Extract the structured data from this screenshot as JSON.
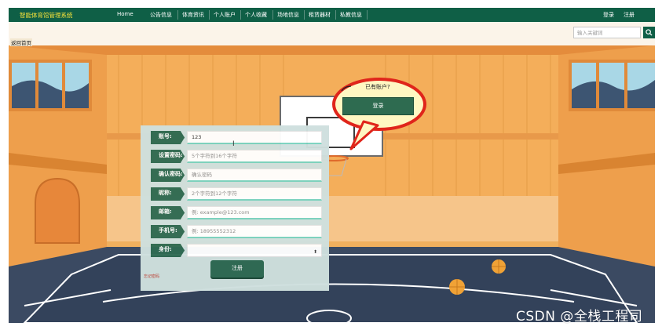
{
  "nav": {
    "brand": "智能体育馆管理系统",
    "items": [
      "Home",
      "公告信息",
      "体育资讯",
      "个人账户",
      "个人收藏",
      "场地信息",
      "租赁器材",
      "私教信息"
    ],
    "login": "登录",
    "register": "注册"
  },
  "search": {
    "placeholder": "输入关键词",
    "icon": "search-icon"
  },
  "back_label": "返回首页",
  "balloon": {
    "text": "已有账户?",
    "login_button": "登录"
  },
  "form": {
    "fields": [
      {
        "label": "账号:",
        "value": "123",
        "placeholder": ""
      },
      {
        "label": "设置密码:",
        "value": "",
        "placeholder": "5个字符到16个字符"
      },
      {
        "label": "确认密码:",
        "value": "",
        "placeholder": "确认密码"
      },
      {
        "label": "昵称:",
        "value": "",
        "placeholder": "2个字符到12个字符"
      },
      {
        "label": "邮箱:",
        "value": "",
        "placeholder": "例: example@123.com"
      },
      {
        "label": "手机号:",
        "value": "",
        "placeholder": "例: 18955552312"
      },
      {
        "label": "身份:",
        "value": "",
        "placeholder": ""
      }
    ],
    "submit": "注册",
    "forgot": "忘记密码"
  },
  "watermark": "CSDN @全栈工程司",
  "colors": {
    "nav_bg": "#0f5f46",
    "brand": "#f7e23a",
    "button": "#2f6b53",
    "field_underline": "#7ad3c0"
  }
}
